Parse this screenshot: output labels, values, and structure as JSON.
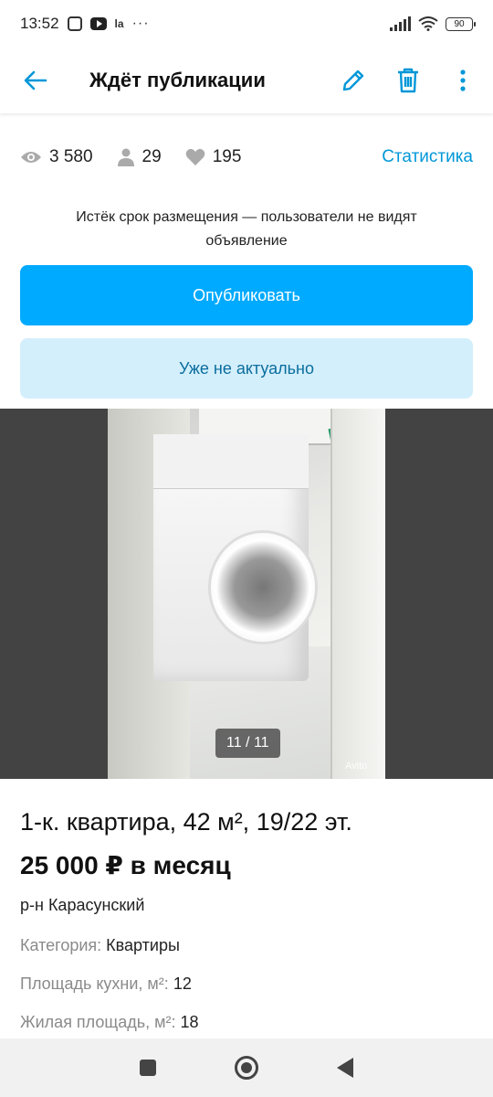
{
  "status_bar": {
    "time": "13:52",
    "notif_la": "la",
    "dots": "···",
    "battery": "90"
  },
  "app_bar": {
    "title": "Ждёт публикации"
  },
  "stats": {
    "views": "3 580",
    "contacts": "29",
    "favorites": "195",
    "link": "Статистика"
  },
  "notice": "Истёк срок размещения — пользователи не видят объявление",
  "buttons": {
    "publish": "Опубликовать",
    "not_actual": "Уже не актуально"
  },
  "gallery": {
    "counter": "11 / 11",
    "brand_mark": "Avito"
  },
  "listing": {
    "title": "1-к. квартира, 42 м², 19/22 эт.",
    "price": "25 000 ₽ в месяц",
    "district": "р-н Карасунский",
    "params": [
      {
        "key": "Категория:",
        "value": "Квартиры"
      },
      {
        "key": "Площадь кухни, м²:",
        "value": "12"
      },
      {
        "key": "Жилая площадь, м²:",
        "value": "18"
      }
    ]
  },
  "colors": {
    "accent": "#00aaff",
    "accent_light": "#d4effc",
    "link": "#0097d8"
  }
}
